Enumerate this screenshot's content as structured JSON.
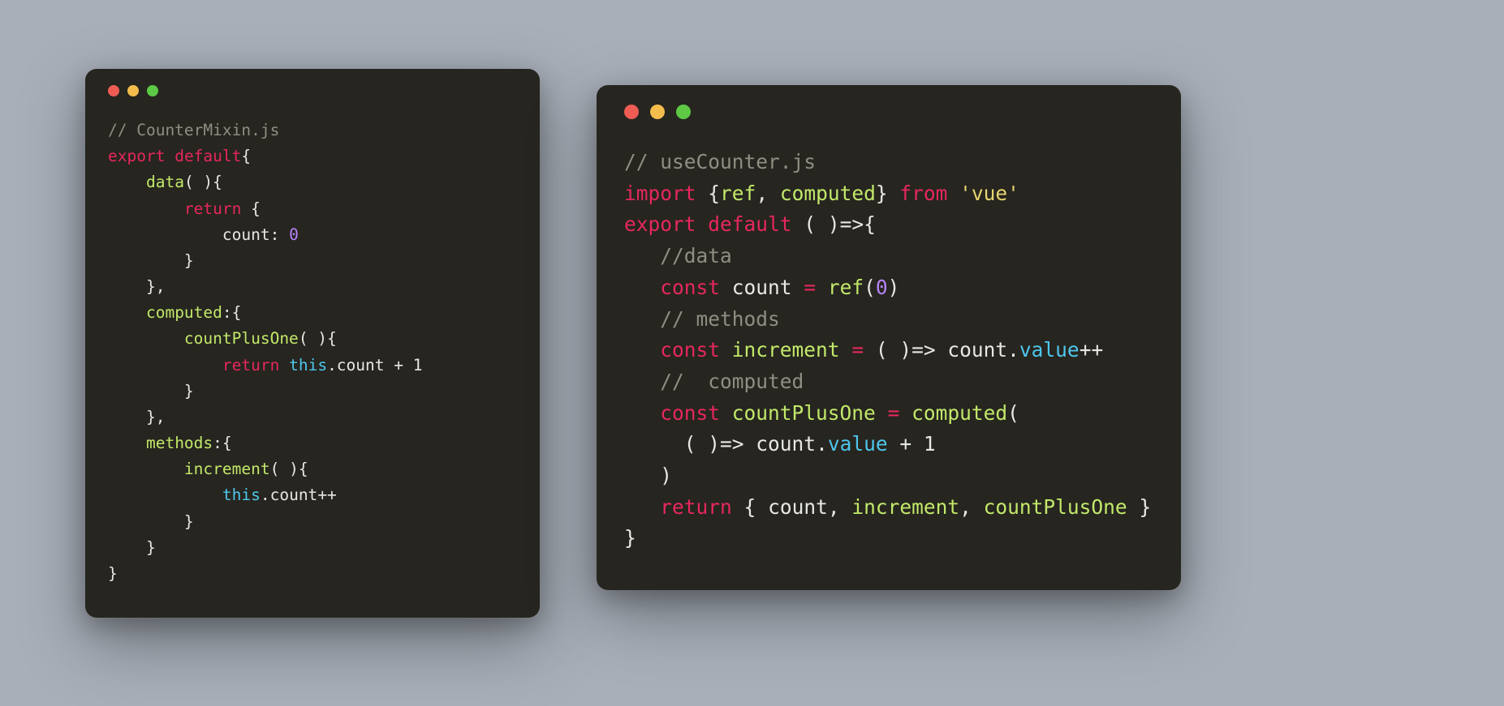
{
  "left": {
    "comment": "// CounterMixin.js",
    "export": "export",
    "default": "default",
    "lbrace1": "{",
    "data": "data",
    "parens1": "( ){",
    "return": "return",
    "lbrace2": "{",
    "count": "count",
    "colon": ":",
    "zero": "0",
    "rbrace2": "}",
    "rbraceComma1": "},",
    "computed": "computed",
    "colonBrace": ":{",
    "countPlusOne": "countPlusOne",
    "parens2": "( ){",
    "return2": "return",
    "this": "this",
    "dotCount": ".count",
    "plusOne": "+ 1",
    "rbrace3": "}",
    "rbraceComma2": "},",
    "methods": "methods",
    "colonBrace2": ":{",
    "increment": "increment",
    "parens3": "( ){",
    "this2": "this",
    "dotCountPP": ".count",
    "pp": "++",
    "rbrace4": "}",
    "rbrace5": "}",
    "rbrace6": "}"
  },
  "right": {
    "comment1": "// useCounter.js",
    "import": "import",
    "lbrace": "{",
    "ref": "ref",
    "comma": ",",
    "computed": "computed",
    "rbrace": "}",
    "from": "from",
    "vue": "'vue'",
    "export": "export",
    "default": "default",
    "arrow1": "( )=>{",
    "commentData": "//data",
    "const1": "const",
    "count": "count",
    "eq1": "=",
    "refCall": "ref",
    "lparen1": "(",
    "zero": "0",
    "rparen1": ")",
    "commentMethods": "// methods",
    "const2": "const",
    "increment": "increment",
    "eq2": "=",
    "arrow2": "( )=>",
    "countDot": "count",
    "dot1": ".",
    "value1": "value",
    "pp": "++",
    "commentComputed": "//  computed",
    "const3": "const",
    "countPlusOne": "countPlusOne",
    "eq3": "=",
    "computedCall": "computed",
    "lparen2": "(",
    "arrow3": "( )=>",
    "countDot2": "count",
    "dot2": ".",
    "value2": "value",
    "plusOne": "+ 1",
    "rparen2": ")",
    "return": "return",
    "retBrace": "{",
    "retCount": "count",
    "retComma1": ",",
    "retIncrement": "increment",
    "retComma2": ",",
    "retCPO": "countPlusOne",
    "retRBrace": "}",
    "finalBrace": "}"
  }
}
